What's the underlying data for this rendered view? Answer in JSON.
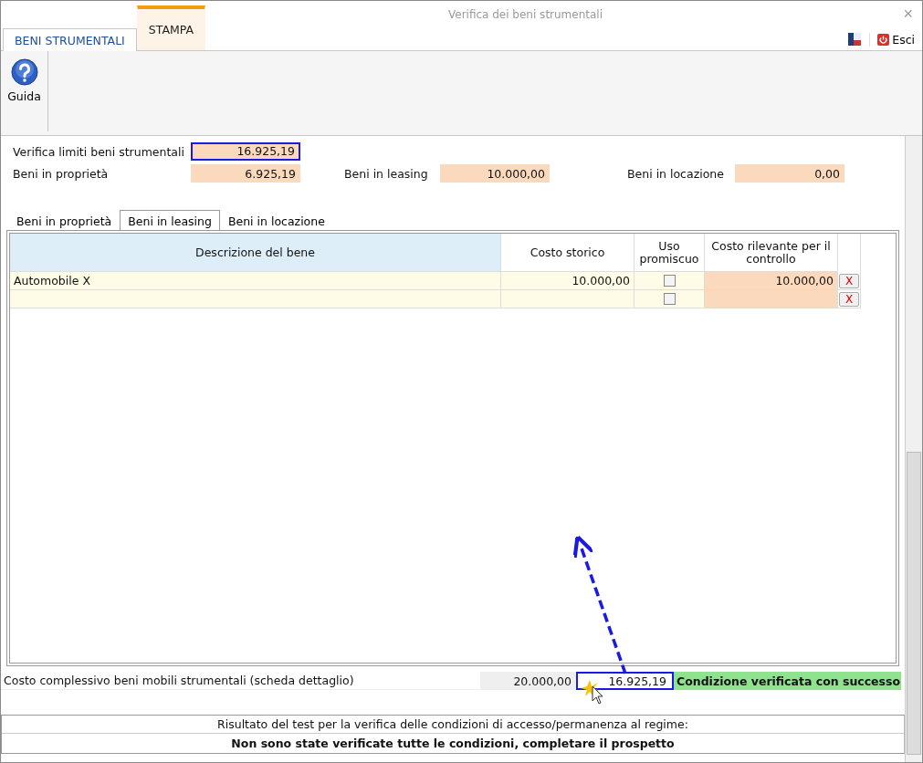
{
  "window": {
    "title": "Verifica dei beni strumentali",
    "close": "×"
  },
  "ribbon_tabs": [
    {
      "label": "BENI STRUMENTALI",
      "selected": true
    },
    {
      "label": "STAMPA",
      "selected": false
    }
  ],
  "exit_button": "Esci",
  "ribbon_buttons": [
    {
      "label": "Guida"
    }
  ],
  "summary": {
    "total": {
      "label": "Verifica limiti beni strumentali",
      "value": "16.925,19",
      "highlighted": true
    },
    "parts": [
      {
        "label": "Beni in proprietà",
        "value": "6.925,19",
        "highlighted": false
      },
      {
        "label": "Beni in leasing",
        "value": "10.000,00",
        "highlighted": false
      },
      {
        "label": "Beni in locazione",
        "value": "0,00",
        "highlighted": false
      }
    ]
  },
  "tabs": [
    {
      "label": "Beni in proprietà",
      "selected": false
    },
    {
      "label": "Beni in leasing",
      "selected": true
    },
    {
      "label": "Beni in locazione",
      "selected": false
    }
  ],
  "table": {
    "columns": [
      "Descrizione del bene",
      "Costo storico",
      "Uso promiscuo",
      "Costo rilevante per il controllo"
    ],
    "rows": [
      {
        "description": "Automobile X",
        "cost": "10.000,00",
        "mixed_use": false,
        "relevant_cost": "10.000,00",
        "delete": "X"
      },
      {
        "mixed_use": false,
        "delete": "X"
      }
    ]
  },
  "footer": {
    "label": "Costo complessivo beni mobili strumentali (scheda dettaglio)",
    "value": "20.000,00",
    "limit": "16.925,19",
    "limit_highlighted": true,
    "status": "Condizione verificata con successo"
  },
  "result": {
    "heading": "Risultato del test per la verifica delle condizioni di accesso/permanenza al regime:",
    "message": "Non sono state verificate tutte le condizioni, completare il prospetto"
  }
}
